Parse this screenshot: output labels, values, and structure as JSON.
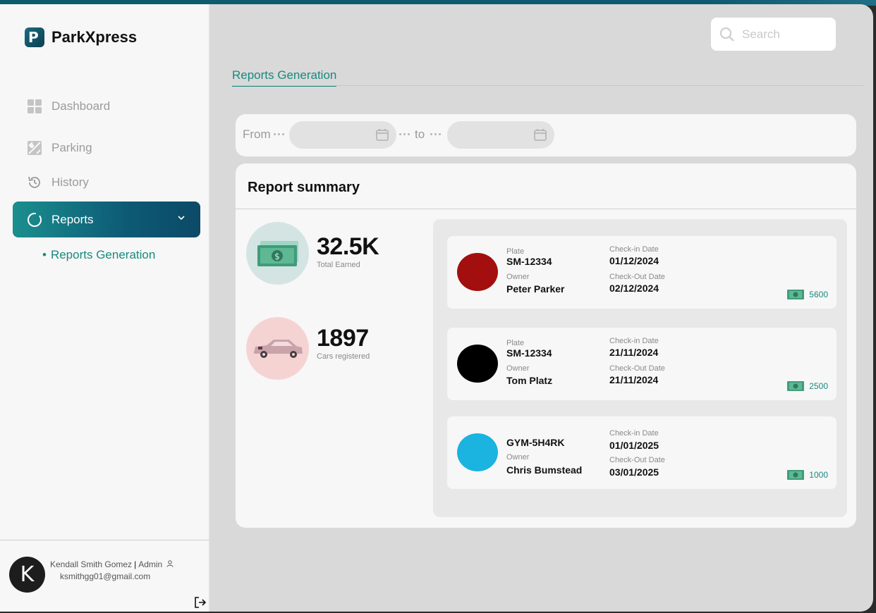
{
  "app": {
    "name": "ParkXpress"
  },
  "search": {
    "placeholder": "Search"
  },
  "nav": {
    "dashboard": "Dashboard",
    "parking": "Parking",
    "history": "History",
    "reports": "Reports",
    "reports_sub": "Reports Generation"
  },
  "tabs": {
    "active": "Reports Generation"
  },
  "filter": {
    "from_label": "From",
    "to_label": "to",
    "from_value": "",
    "to_value": ""
  },
  "summary": {
    "title": "Report summary",
    "total_earned": {
      "value": "32.5K",
      "label": "Total Earned"
    },
    "cars_registered": {
      "value": "1897",
      "label": "Cars registered"
    }
  },
  "labels": {
    "plate": "Plate",
    "owner": "Owner",
    "checkin": "Check-in Date",
    "checkout": "Check-Out Date"
  },
  "records": [
    {
      "color": "#a30e0e",
      "plate": "SM-12334",
      "owner": "Peter Parker",
      "checkin": "01/12/2024",
      "checkout": "02/12/2024",
      "amount": "5600"
    },
    {
      "color": "#000000",
      "plate": "SM-12334",
      "owner": "Tom Platz",
      "checkin": "21/11/2024",
      "checkout": "21/11/2024",
      "amount": "2500"
    },
    {
      "color": "#1bb3df",
      "plate": "GYM-5H4RK",
      "owner": "Chris Bumstead",
      "checkin": "01/01/2025",
      "checkout": "03/01/2025",
      "amount": "1000"
    }
  ],
  "user": {
    "name": "Kendall Smith Gomez",
    "role": "Admin",
    "email": "ksmithgg01@gmail.com",
    "initial": "K"
  },
  "colors": {
    "accent": "#19897f",
    "nav_active_start": "#1b8f8f",
    "nav_active_end": "#0c4a66"
  }
}
